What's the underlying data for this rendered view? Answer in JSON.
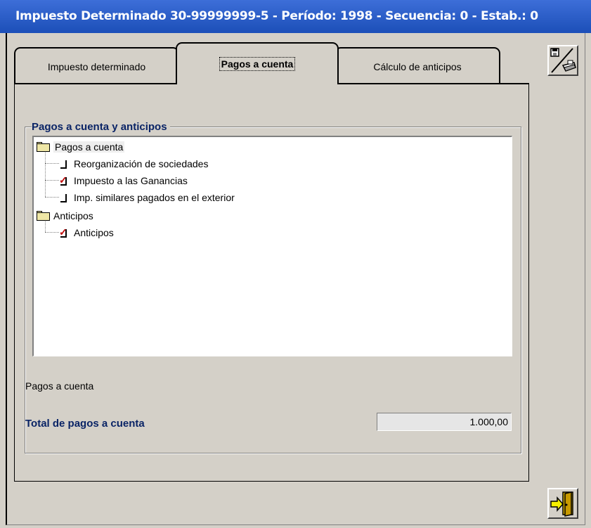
{
  "window": {
    "title": "Impuesto Determinado 30-99999999-5 - Período: 1998 - Secuencia: 0 - Estab.: 0"
  },
  "tabs": [
    {
      "label": "Impuesto determinado",
      "selected": false
    },
    {
      "label": "Pagos a cuenta",
      "selected": true
    },
    {
      "label": "Cálculo de anticipos",
      "selected": false
    }
  ],
  "group": {
    "title": "Pagos a cuenta y anticipos"
  },
  "tree": {
    "folders": [
      {
        "label": "Pagos a cuenta",
        "items": [
          {
            "label": "Reorganización de sociedades",
            "checked": false
          },
          {
            "label": "Impuesto a las Ganancias",
            "checked": true
          },
          {
            "label": "Imp. similares pagados en el exterior",
            "checked": false
          }
        ]
      },
      {
        "label": "Anticipos",
        "items": [
          {
            "label": "Anticipos",
            "checked": true
          }
        ]
      }
    ]
  },
  "summary": {
    "section_label": "Pagos a cuenta",
    "total_label": "Total de pagos a cuenta",
    "total_value": "1.000,00"
  },
  "toolbar": {
    "print_icon": "save-print-icon",
    "exit_icon": "exit-door-icon"
  },
  "colors": {
    "title_bar": "#2a5bc8",
    "label_blue": "#0a2466",
    "check_red": "#c00000",
    "background": "#d4d0c8"
  }
}
